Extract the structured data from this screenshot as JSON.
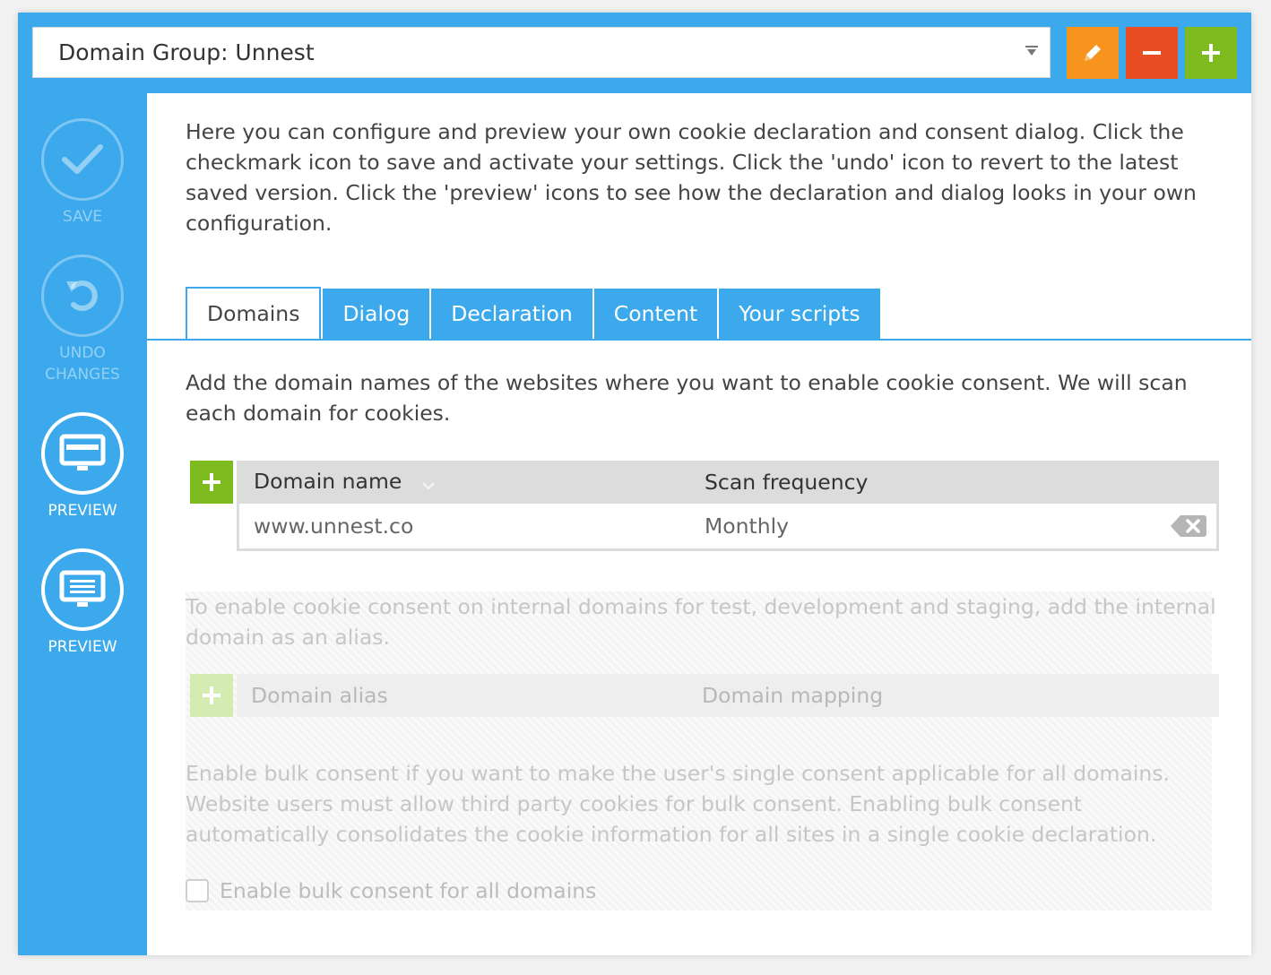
{
  "header": {
    "domain_group": "Domain Group: Unnest",
    "dropdown_glyph": "⌅"
  },
  "toolbar": {
    "edit_icon": "pencil-icon",
    "delete_icon": "minus-icon",
    "add_icon": "plus-icon"
  },
  "sidebar": {
    "save_label": "SAVE",
    "undo_label_1": "UNDO",
    "undo_label_2": "CHANGES",
    "preview_dialog_label": "PREVIEW",
    "preview_declaration_label": "PREVIEW"
  },
  "intro": "Here you can configure and preview your own cookie declaration and consent dialog. Click the checkmark icon to save and activate your settings. Click the 'undo' icon to revert to the latest saved version. Click the 'preview' icons to see how the declaration and dialog looks in your own configuration.",
  "tabs": [
    {
      "label": "Domains",
      "active": true
    },
    {
      "label": "Dialog",
      "active": false
    },
    {
      "label": "Declaration",
      "active": false
    },
    {
      "label": "Content",
      "active": false
    },
    {
      "label": "Your scripts",
      "active": false
    }
  ],
  "domains": {
    "description": "Add the domain names of the websites where you want to enable cookie consent. We will scan each domain for cookies.",
    "columns": [
      "Domain name",
      "Scan frequency"
    ],
    "rows": [
      {
        "domain": "www.unnest.co",
        "frequency": "Monthly"
      }
    ]
  },
  "aliases": {
    "description": "To enable cookie consent on internal domains for test, development and staging, add the internal domain as an alias.",
    "columns": [
      "Domain alias",
      "Domain mapping"
    ]
  },
  "bulk": {
    "description": "Enable bulk consent if you want to make the user's single consent applicable for all domains. Website users must allow third party cookies for bulk consent. Enabling bulk consent automatically consolidates the cookie information for all sites in a single cookie declaration.",
    "checkbox_label": "Enable bulk consent for all domains",
    "checked": false
  },
  "colors": {
    "accent": "#3ba9ec",
    "edit": "#f7941d",
    "delete": "#e84d24",
    "add": "#7dbb1f"
  }
}
